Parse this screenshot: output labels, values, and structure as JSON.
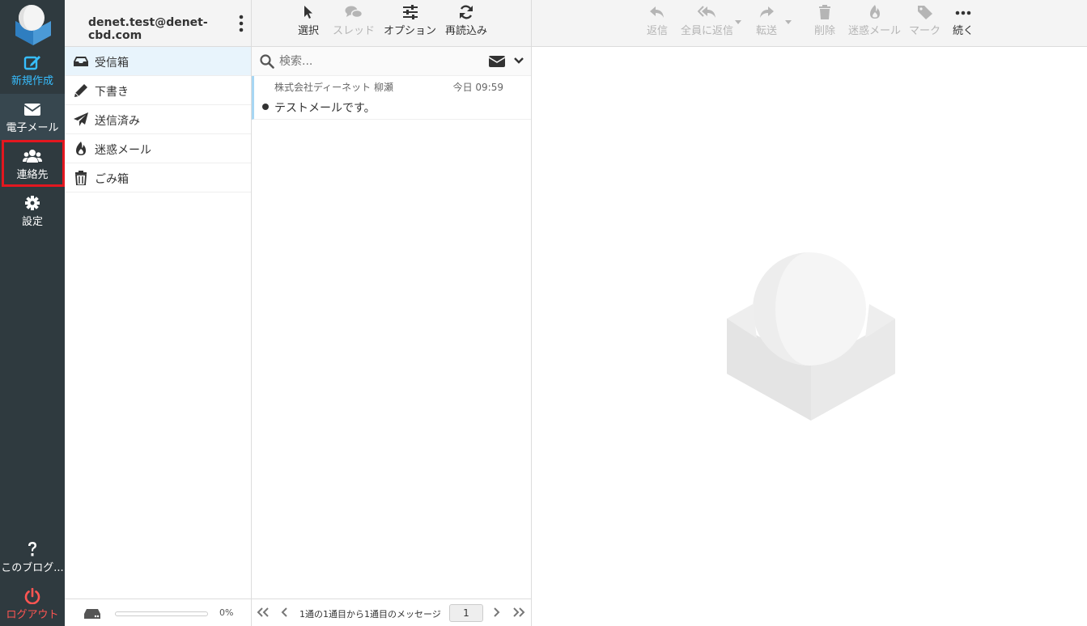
{
  "nav": {
    "compose": "新規作成",
    "mail": "電子メール",
    "contacts": "連絡先",
    "settings": "設定",
    "help": "このブログ...",
    "logout": "ログアウト",
    "accent_color": "#37beff",
    "logout_color": "#ff5552",
    "highlight_color": "#e3171f"
  },
  "account": {
    "email": "denet.test@denet-cbd.com"
  },
  "folders": [
    {
      "label": "受信箱",
      "icon": "inbox-icon"
    },
    {
      "label": "下書き",
      "icon": "pencil-icon"
    },
    {
      "label": "送信済み",
      "icon": "paper-plane-icon"
    },
    {
      "label": "迷惑メール",
      "icon": "fire-icon"
    },
    {
      "label": "ごみ箱",
      "icon": "trash-icon"
    }
  ],
  "quota": {
    "percent_label": "0%",
    "fraction": 0
  },
  "list_toolbar": {
    "select": "選択",
    "thread": "スレッド",
    "options": "オプション",
    "refresh": "再読込み"
  },
  "search": {
    "placeholder": "検索..."
  },
  "messages": [
    {
      "from": "株式会社ディーネット 柳瀬",
      "date": "今日 09:59",
      "subject": "テストメールです。"
    }
  ],
  "pager": {
    "text": "1通の1通目から1通目のメッセージ",
    "page": "1"
  },
  "reader_toolbar": {
    "reply": "返信",
    "reply_all": "全員に返信",
    "forward": "転送",
    "delete": "削除",
    "junk": "迷惑メール",
    "mark": "マーク",
    "more": "続く"
  }
}
